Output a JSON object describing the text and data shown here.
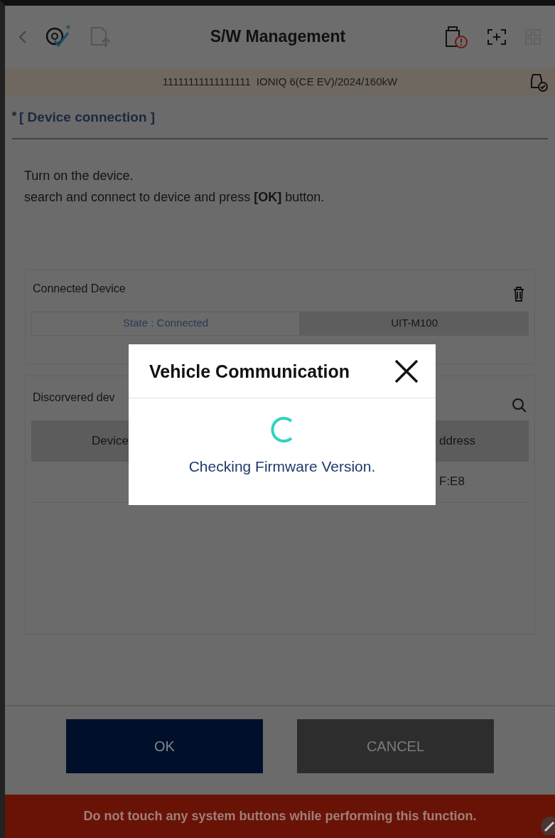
{
  "header": {
    "title": "S/W Management"
  },
  "vehicle_bar": {
    "vin": "11111111111111111",
    "model": "IONIQ 6(CE EV)/2024/160kW"
  },
  "section": {
    "title": "[ Device connection ]"
  },
  "instructions": [
    "Turn on the device.",
    "search and connect to device and press **[OK]** button."
  ],
  "connected_device": {
    "title": "Connected Device",
    "state": "State : Connected",
    "device": "UIT-M100"
  },
  "discovered_devices": {
    "title": "Discorvered dev",
    "columns": [
      "Device",
      "ddress"
    ],
    "rows": [
      {
        "address": "F:E8"
      }
    ]
  },
  "buttons": [
    {
      "label": "OK",
      "kind": "primary"
    },
    {
      "label": "CANCEL",
      "kind": "secondary"
    }
  ],
  "warning": "Do not touch any system buttons while performing this function.",
  "dialog": {
    "title": "Vehicle Communication",
    "message": "Checking Firmware Version."
  }
}
